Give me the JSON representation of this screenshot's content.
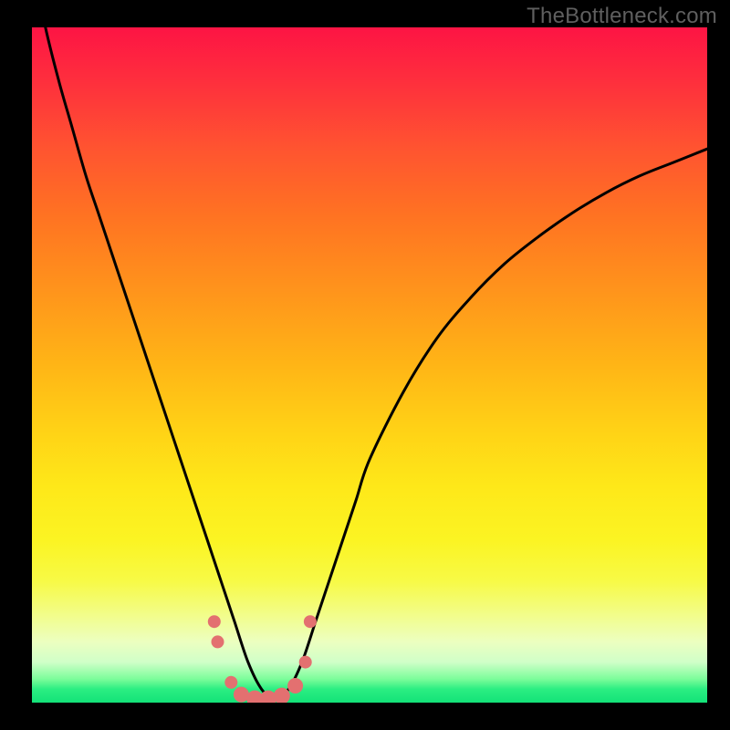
{
  "watermark": "TheBottleneck.com",
  "colors": {
    "frame": "#000000",
    "curve": "#000000",
    "marker": "#e37070",
    "gradient_top": "#fd1444",
    "gradient_bottom": "#13e278"
  },
  "chart_data": {
    "type": "line",
    "title": "",
    "xlabel": "",
    "ylabel": "",
    "xlim": [
      0,
      100
    ],
    "ylim": [
      0,
      100
    ],
    "x": [
      0,
      2,
      4,
      6,
      8,
      10,
      12,
      14,
      16,
      18,
      20,
      22,
      24,
      26,
      28,
      30,
      32,
      34,
      36,
      38,
      40,
      42,
      44,
      46,
      48,
      50,
      55,
      60,
      65,
      70,
      75,
      80,
      85,
      90,
      95,
      100
    ],
    "y": [
      110,
      100,
      92,
      85,
      78,
      72,
      66,
      60,
      54,
      48,
      42,
      36,
      30,
      24,
      18,
      12,
      6,
      2,
      0.5,
      2,
      6,
      12,
      18,
      24,
      30,
      36,
      46,
      54,
      60,
      65,
      69,
      72.5,
      75.5,
      78,
      80,
      82
    ],
    "series": [
      {
        "name": "bottleneck-curve",
        "x": [
          0,
          2,
          4,
          6,
          8,
          10,
          12,
          14,
          16,
          18,
          20,
          22,
          24,
          26,
          28,
          30,
          32,
          34,
          36,
          38,
          40,
          42,
          44,
          46,
          48,
          50,
          55,
          60,
          65,
          70,
          75,
          80,
          85,
          90,
          95,
          100
        ],
        "y": [
          110,
          100,
          92,
          85,
          78,
          72,
          66,
          60,
          54,
          48,
          42,
          36,
          30,
          24,
          18,
          12,
          6,
          2,
          0.5,
          2,
          6,
          12,
          18,
          24,
          30,
          36,
          46,
          54,
          60,
          65,
          69,
          72.5,
          75.5,
          78,
          80,
          82
        ]
      }
    ],
    "markers": {
      "x": [
        27,
        27.5,
        29.5,
        31,
        33,
        35,
        37,
        39,
        40.5,
        41.2
      ],
      "y": [
        12,
        9,
        3,
        1.2,
        0.6,
        0.6,
        1.0,
        2.5,
        6,
        12
      ],
      "r": [
        7,
        7,
        7,
        8.5,
        9,
        9,
        9,
        8.5,
        7,
        7
      ]
    }
  }
}
